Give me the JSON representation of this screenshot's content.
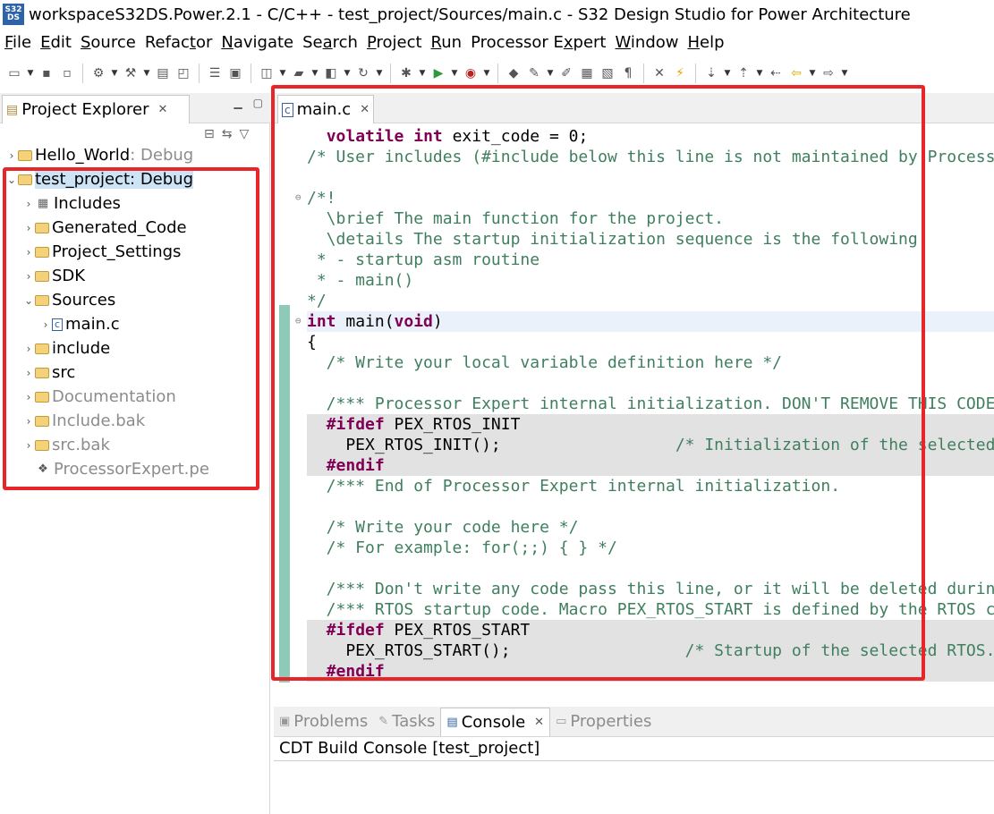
{
  "window": {
    "title": "workspaceS32DS.Power.2.1 - C/C++ - test_project/Sources/main.c - S32 Design Studio for Power Architecture",
    "icon_text": "S32\nDS"
  },
  "menu": [
    {
      "pre": "",
      "u": "F",
      "post": "ile"
    },
    {
      "pre": "",
      "u": "E",
      "post": "dit"
    },
    {
      "pre": "",
      "u": "S",
      "post": "ource"
    },
    {
      "pre": "Refac",
      "u": "t",
      "post": "or"
    },
    {
      "pre": "",
      "u": "N",
      "post": "avigate"
    },
    {
      "pre": "Se",
      "u": "a",
      "post": "rch"
    },
    {
      "pre": "",
      "u": "P",
      "post": "roject"
    },
    {
      "pre": "",
      "u": "R",
      "post": "un"
    },
    {
      "pre": "Processor E",
      "u": "x",
      "post": "pert"
    },
    {
      "pre": "",
      "u": "W",
      "post": "indow"
    },
    {
      "pre": "",
      "u": "H",
      "post": "elp"
    }
  ],
  "project_explorer": {
    "tab_label": "Project Explorer",
    "tree": [
      {
        "label": "Hello_World",
        "suffix": ": Debug",
        "indent": 0,
        "chev": "›",
        "icon": "project-folder-icon",
        "dim": false,
        "sel": false
      },
      {
        "label": "test_project: Debug",
        "suffix": "",
        "indent": 0,
        "chev": "⌄",
        "icon": "project-folder-icon",
        "dim": false,
        "sel": true
      },
      {
        "label": "Includes",
        "suffix": "",
        "indent": 1,
        "chev": "›",
        "icon": "includes-icon",
        "dim": false,
        "sel": false
      },
      {
        "label": "Generated_Code",
        "suffix": "",
        "indent": 1,
        "chev": "›",
        "icon": "folder-icon",
        "dim": false,
        "sel": false
      },
      {
        "label": "Project_Settings",
        "suffix": "",
        "indent": 1,
        "chev": "›",
        "icon": "folder-icon",
        "dim": false,
        "sel": false
      },
      {
        "label": "SDK",
        "suffix": "",
        "indent": 1,
        "chev": "›",
        "icon": "folder-icon",
        "dim": false,
        "sel": false
      },
      {
        "label": "Sources",
        "suffix": "",
        "indent": 1,
        "chev": "⌄",
        "icon": "folder-icon",
        "dim": false,
        "sel": false
      },
      {
        "label": "main.c",
        "suffix": "",
        "indent": 2,
        "chev": "›",
        "icon": "c-file-icon",
        "dim": false,
        "sel": false
      },
      {
        "label": "include",
        "suffix": "",
        "indent": 1,
        "chev": "›",
        "icon": "folder-icon",
        "dim": false,
        "sel": false
      },
      {
        "label": "src",
        "suffix": "",
        "indent": 1,
        "chev": "›",
        "icon": "folder-icon",
        "dim": false,
        "sel": false
      },
      {
        "label": "Documentation",
        "suffix": "",
        "indent": 1,
        "chev": "›",
        "icon": "folder-icon",
        "dim": true,
        "sel": false
      },
      {
        "label": "Include.bak",
        "suffix": "",
        "indent": 1,
        "chev": "›",
        "icon": "folder-icon",
        "dim": true,
        "sel": false
      },
      {
        "label": "src.bak",
        "suffix": "",
        "indent": 1,
        "chev": "›",
        "icon": "folder-icon",
        "dim": true,
        "sel": false
      },
      {
        "label": "ProcessorExpert.pe",
        "suffix": "",
        "indent": 1,
        "chev": "",
        "icon": "processor-expert-icon",
        "dim": true,
        "sel": false
      }
    ]
  },
  "editor": {
    "tab_label": "main.c",
    "lines": [
      {
        "text": "  volatile int exit_code = 0;",
        "style": "",
        "kind": "code"
      },
      {
        "text": "/* User includes (#include below this line is not maintained by Processor Expert) */",
        "style": "",
        "kind": "comment"
      },
      {
        "text": "",
        "style": "",
        "kind": "code"
      },
      {
        "text": "/*!",
        "style": "",
        "kind": "comment",
        "fold": true
      },
      {
        "text": "  \\brief The main function for the project.",
        "style": "",
        "kind": "comment"
      },
      {
        "text": "  \\details The startup initialization sequence is the following:",
        "style": "",
        "kind": "comment"
      },
      {
        "text": " * - startup asm routine",
        "style": "",
        "kind": "comment"
      },
      {
        "text": " * - main()",
        "style": "",
        "kind": "comment"
      },
      {
        "text": "*/",
        "style": "",
        "kind": "comment"
      },
      {
        "text": "int main(void)",
        "style": "current",
        "kind": "code",
        "fold": true
      },
      {
        "text": "{",
        "style": "",
        "kind": "code"
      },
      {
        "text": "  /* Write your local variable definition here */",
        "style": "",
        "kind": "comment"
      },
      {
        "text": "",
        "style": "",
        "kind": "code"
      },
      {
        "text": "  /*** Processor Expert internal initialization. DON'T REMOVE THIS CODE!!! ***/",
        "style": "",
        "kind": "comment"
      },
      {
        "text": "  #ifdef PEX_RTOS_INIT",
        "style": "shaded",
        "kind": "pp"
      },
      {
        "text": "    PEX_RTOS_INIT();                  /* Initialization of the selected RTOS. Macro is defined by the RTOS component. */",
        "style": "shaded",
        "kind": "mixed"
      },
      {
        "text": "  #endif",
        "style": "shaded",
        "kind": "pp"
      },
      {
        "text": "  /*** End of Processor Expert internal initialization.                    ***/",
        "style": "",
        "kind": "comment"
      },
      {
        "text": "",
        "style": "",
        "kind": "code"
      },
      {
        "text": "  /* Write your code here */",
        "style": "",
        "kind": "comment"
      },
      {
        "text": "  /* For example: for(;;) { } */",
        "style": "",
        "kind": "comment"
      },
      {
        "text": "",
        "style": "",
        "kind": "code"
      },
      {
        "text": "  /*** Don't write any code pass this line, or it will be deleted during code generation. ***/",
        "style": "",
        "kind": "comment"
      },
      {
        "text": "  /*** RTOS startup code. Macro PEX_RTOS_START is defined by the RTOS component. DON'T MODIFY THIS CODE!!! ***/",
        "style": "",
        "kind": "comment"
      },
      {
        "text": "  #ifdef PEX_RTOS_START",
        "style": "shaded",
        "kind": "pp"
      },
      {
        "text": "    PEX_RTOS_START();                  /* Startup of the selected RTOS. Macro is defined by the RTOS component. */",
        "style": "shaded",
        "kind": "mixed"
      },
      {
        "text": "  #endif",
        "style": "shaded",
        "kind": "pp"
      }
    ]
  },
  "bottom": {
    "tabs": [
      {
        "label": "Problems",
        "icon": "problems-icon",
        "active": false
      },
      {
        "label": "Tasks",
        "icon": "tasks-icon",
        "active": false
      },
      {
        "label": "Console",
        "icon": "console-icon",
        "active": true
      },
      {
        "label": "Properties",
        "icon": "properties-icon",
        "active": false
      }
    ],
    "console_title": "CDT Build Console [test_project]"
  },
  "colors": {
    "highlight_box": "#e8262a",
    "selection": "#cde4f7",
    "keyword": "#7f0055",
    "comment": "#3f7f5f"
  }
}
